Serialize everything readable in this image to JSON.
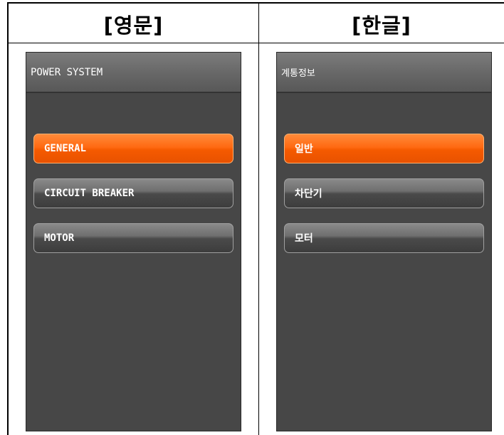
{
  "columns": [
    {
      "header": "[영문]",
      "screen_title": "POWER SYSTEM",
      "menu": [
        {
          "label": "GENERAL",
          "selected": true
        },
        {
          "label": "CIRCUIT BREAKER",
          "selected": false
        },
        {
          "label": "MOTOR",
          "selected": false
        }
      ]
    },
    {
      "header": "[한글]",
      "screen_title": "계통정보",
      "menu": [
        {
          "label": "일반",
          "selected": true
        },
        {
          "label": "차단기",
          "selected": false
        },
        {
          "label": "모터",
          "selected": false
        }
      ]
    }
  ],
  "colors": {
    "selected": "#ff6a12",
    "unselected": "#5a5a5a",
    "screen_bg": "#474747"
  }
}
